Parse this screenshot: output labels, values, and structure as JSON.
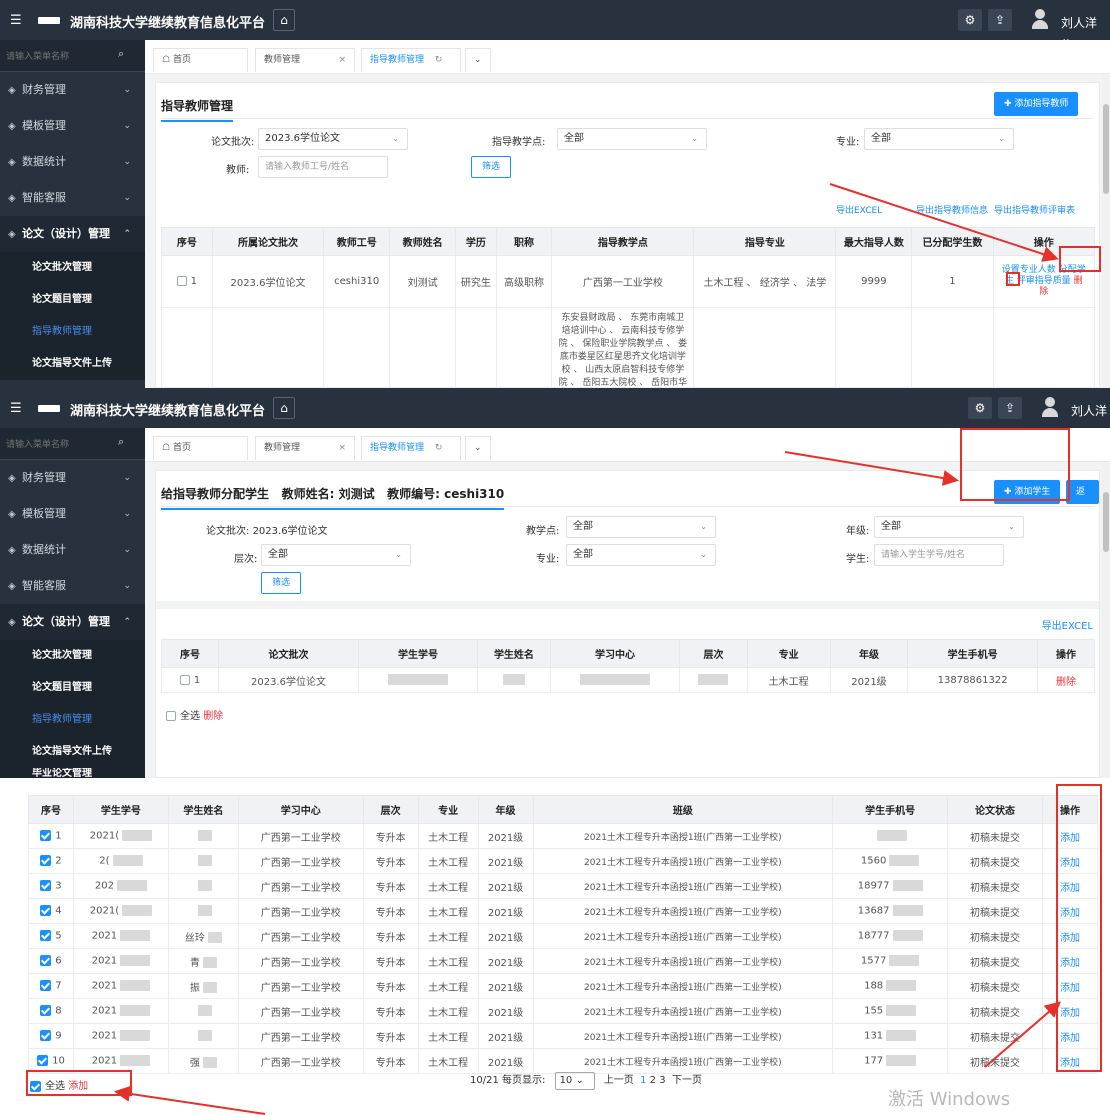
{
  "platform_title": "湖南科技大学继续教育信息化平台",
  "user_name": "刘人洋",
  "sidebar": {
    "search_placeholder": "请输入菜单名称",
    "menu": [
      "财务管理",
      "模板管理",
      "数据统计",
      "智能客服"
    ],
    "open_menu": "论文（设计）管理",
    "sub_items": [
      "论文批次管理",
      "论文题目管理",
      "指导教师管理",
      "论文指导文件上传"
    ],
    "extra_item": "毕业论文管理"
  },
  "tabs": {
    "home": "首页",
    "teacher_mgmt": "教师管理",
    "supervisor_mgmt": "指导教师管理"
  },
  "panel1": {
    "title": "指导教师管理",
    "add_btn": "添加指导教师",
    "batch_label": "论文批次:",
    "batch_value": "2023.6学位论文",
    "site_label": "指导教学点:",
    "site_value": "全部",
    "major_label": "专业:",
    "major_value": "全部",
    "teacher_label": "教师:",
    "teacher_placeholder": "请输入教师工号/姓名",
    "filter_btn": "筛选",
    "export_links": [
      "导出EXCEL",
      "导出指导教师信息",
      "导出指导教师评审表"
    ],
    "headers": [
      "序号",
      "所属论文批次",
      "教师工号",
      "教师姓名",
      "学历",
      "职称",
      "指导教学点",
      "指导专业",
      "最大指导人数",
      "已分配学生数",
      "操作"
    ],
    "row": {
      "no": "1",
      "batch": "2023.6学位论文",
      "id": "ceshi310",
      "name": "刘测试",
      "edu": "研究生",
      "title": "高级职称",
      "site": "广西第一工业学校",
      "major": "土木工程 、 经济学 、 法学",
      "max": "9999",
      "assigned": "1"
    },
    "ops": {
      "set_major": "设置专业人数",
      "assign": "分配学",
      "assign2": "生",
      "review_quality": "评审指导质量",
      "delete": "删",
      "delete2": "除"
    },
    "row2_site": "东安县财政局 、 东莞市南城卫培培训中心 、 云南科技专修学院 、 保险职业学院教学点 、 娄底市娄星区红星思齐文化培训学校 、 山西太原启智科技专修学院 、 岳阳五大院校 、 岳阳市华"
  },
  "panel2": {
    "title": "给指导教师分配学生",
    "teacher_name_label": "教师姓名:",
    "teacher_name": "刘测试",
    "teacher_no_label": "教师编号:",
    "teacher_no": "ceshi310",
    "add_student_btn": "添加学生",
    "back_btn": "返回",
    "batch_label": "论文批次:",
    "batch_value": "2023.6学位论文",
    "site_label": "教学点:",
    "site_value": "全部",
    "grade_label": "年级:",
    "grade_value": "全部",
    "level_label": "层次:",
    "level_value": "全部",
    "major_label": "专业:",
    "major_value": "全部",
    "student_label": "学生:",
    "student_placeholder": "请输入学生学号/姓名",
    "filter_btn": "筛选",
    "export": "导出EXCEL",
    "headers": [
      "序号",
      "论文批次",
      "学生学号",
      "学生姓名",
      "学习中心",
      "层次",
      "专业",
      "年级",
      "学生手机号",
      "操作"
    ],
    "row": {
      "no": "1",
      "batch": "2023.6学位论文",
      "major": "土木工程",
      "grade": "2021级",
      "phone": "13878861322",
      "op": "删除"
    },
    "select_all": "全选",
    "delete": "删除"
  },
  "panel3": {
    "headers": [
      "序号",
      "学生学号",
      "学生姓名",
      "学习中心",
      "层次",
      "专业",
      "年级",
      "班级",
      "学生手机号",
      "论文状态",
      "操作"
    ],
    "rows": [
      {
        "no": "1",
        "sid": "2021(",
        "name": "",
        "center": "广西第一工业学校",
        "level": "专升本",
        "major": "土木工程",
        "grade": "2021级",
        "cls": "2021土木工程专升本函授1班(广西第一工业学校)",
        "phone": "",
        "status": "初稿未提交",
        "op": "添加"
      },
      {
        "no": "2",
        "sid": "2(",
        "name": "",
        "center": "广西第一工业学校",
        "level": "专升本",
        "major": "土木工程",
        "grade": "2021级",
        "cls": "2021土木工程专升本函授1班(广西第一工业学校)",
        "phone": "1560",
        "status": "初稿未提交",
        "op": "添加"
      },
      {
        "no": "3",
        "sid": "202",
        "name": "",
        "center": "广西第一工业学校",
        "level": "专升本",
        "major": "土木工程",
        "grade": "2021级",
        "cls": "2021土木工程专升本函授1班(广西第一工业学校)",
        "phone": "18977",
        "status": "初稿未提交",
        "op": "添加"
      },
      {
        "no": "4",
        "sid": "2021(",
        "name": "",
        "center": "广西第一工业学校",
        "level": "专升本",
        "major": "土木工程",
        "grade": "2021级",
        "cls": "2021土木工程专升本函授1班(广西第一工业学校)",
        "phone": "13687",
        "status": "初稿未提交",
        "op": "添加"
      },
      {
        "no": "5",
        "sid": "2021",
        "name": "丝玲",
        "center": "广西第一工业学校",
        "level": "专升本",
        "major": "土木工程",
        "grade": "2021级",
        "cls": "2021土木工程专升本函授1班(广西第一工业学校)",
        "phone": "18777",
        "status": "初稿未提交",
        "op": "添加"
      },
      {
        "no": "6",
        "sid": "2021",
        "name": "青",
        "center": "广西第一工业学校",
        "level": "专升本",
        "major": "土木工程",
        "grade": "2021级",
        "cls": "2021土木工程专升本函授1班(广西第一工业学校)",
        "phone": "1577",
        "status": "初稿未提交",
        "op": "添加"
      },
      {
        "no": "7",
        "sid": "2021",
        "name": "振",
        "center": "广西第一工业学校",
        "level": "专升本",
        "major": "土木工程",
        "grade": "2021级",
        "cls": "2021土木工程专升本函授1班(广西第一工业学校)",
        "phone": "188",
        "status": "初稿未提交",
        "op": "添加"
      },
      {
        "no": "8",
        "sid": "2021",
        "name": "",
        "center": "广西第一工业学校",
        "level": "专升本",
        "major": "土木工程",
        "grade": "2021级",
        "cls": "2021土木工程专升本函授1班(广西第一工业学校)",
        "phone": "155",
        "status": "初稿未提交",
        "op": "添加"
      },
      {
        "no": "9",
        "sid": "2021",
        "name": "",
        "center": "广西第一工业学校",
        "level": "专升本",
        "major": "土木工程",
        "grade": "2021级",
        "cls": "2021土木工程专升本函授1班(广西第一工业学校)",
        "phone": "131",
        "status": "初稿未提交",
        "op": "添加"
      },
      {
        "no": "10",
        "sid": "2021",
        "name": "强",
        "center": "广西第一工业学校",
        "level": "专升本",
        "major": "土木工程",
        "grade": "2021级",
        "cls": "2021土木工程专升本函授1班(广西第一工业学校)",
        "phone": "177",
        "status": "初稿未提交",
        "op": "添加"
      }
    ],
    "select_all": "全选",
    "add": "添加",
    "pager_info": "10/21 每页显示:",
    "page_size": "10",
    "prev": "上一页",
    "pages": [
      "1",
      "2",
      "3"
    ],
    "next": "下一页"
  },
  "watermark": "激活 Windows",
  "colors": {
    "topbar": "#28323e",
    "accent": "#1890ff",
    "annotation": "#e8302b",
    "danger": "#e6353c"
  }
}
